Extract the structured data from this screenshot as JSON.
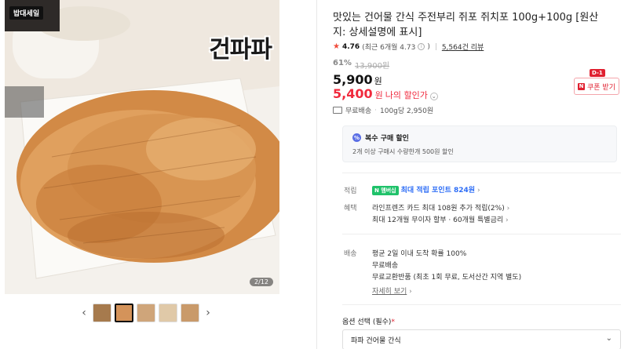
{
  "gallery": {
    "brand_tag": "밥대세일",
    "sticker_text": "건파파",
    "counter": "2/12",
    "thumb_count": 5,
    "prev_label": "‹",
    "next_label": "›"
  },
  "product": {
    "title": "맛있는 건어물 간식 주전부리 쥐포 쥐치포 100g+100g [원산지: 상세설명에 표시]",
    "rating": "4.76",
    "rating_recent": "(최근 6개월 4.73",
    "review_count": "5,564건 리뷰",
    "discount_pct": "61%",
    "original_price": "13,900원",
    "price": "5,900",
    "price_unit": "원",
    "my_price": "5,400",
    "my_price_unit": "원",
    "my_price_label": "나의 할인가",
    "coupon_label": "쿠폰 받기",
    "coupon_dday": "D-1",
    "shipping_free": "무료배송",
    "unit_price": "100g당 2,950원"
  },
  "bundle": {
    "title": "복수 구매 할인",
    "desc": "2개 이상 구매시 수량한개 500원 할인"
  },
  "points": {
    "label": "적립",
    "badge": "N 멤버십",
    "text": "최대 적립 포인트 824원"
  },
  "benefits": {
    "label": "혜택",
    "line1": "라인프렌즈 카드 최대 108원 추가 적립(2%)",
    "line2": "최대 12개월 무이자 할부 · 60개월 특별금리"
  },
  "delivery": {
    "label": "배송",
    "line1": "평균 2일 이내 도착 확률 100%",
    "line2": "무료배송",
    "line3": "무료교환반품 (최초 1회 무료, 도서산간 지역 별도)",
    "more": "자세히 보기"
  },
  "option": {
    "label": "옵션 선택 (필수)",
    "required_mark": "*",
    "selected": "파파 건어물 간식"
  },
  "colors": {
    "accent": "#f02a3d",
    "point_blue": "#2d6df6",
    "naver_green": "#1fc26a"
  }
}
